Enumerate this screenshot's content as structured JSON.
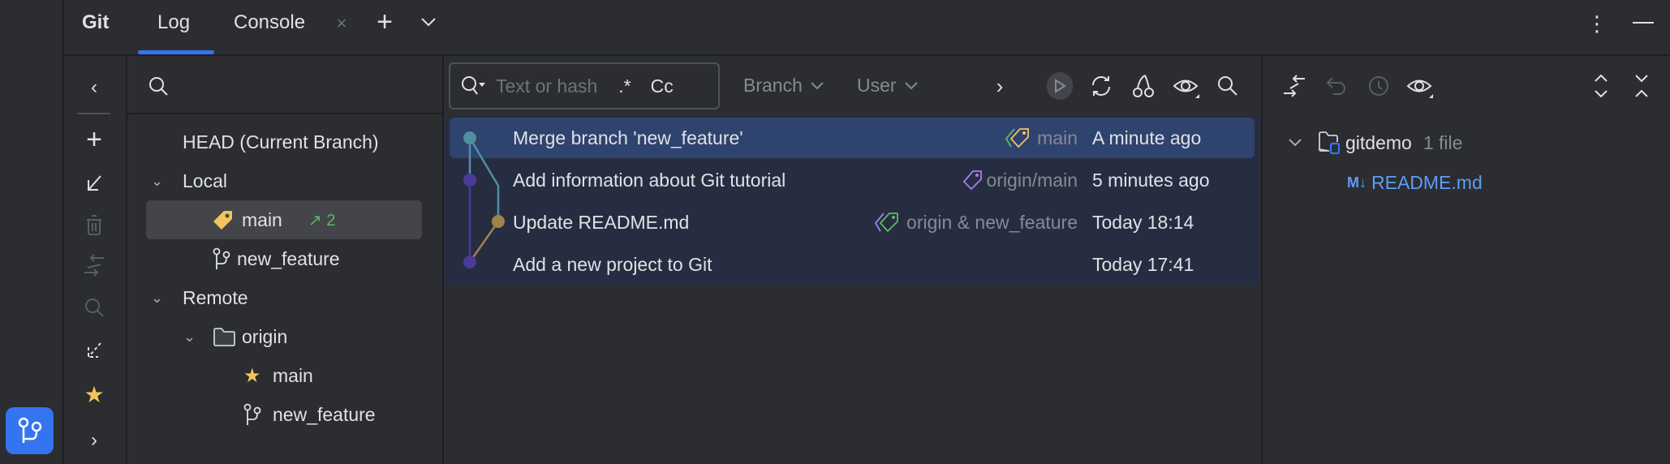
{
  "header": {
    "title": "Git",
    "tabs": [
      {
        "label": "Log",
        "active": true
      },
      {
        "label": "Console"
      }
    ]
  },
  "branches": {
    "head": "HEAD (Current Branch)",
    "local_label": "Local",
    "local": [
      {
        "name": "main",
        "ahead": "2",
        "selected": true
      },
      {
        "name": "new_feature"
      }
    ],
    "remote_label": "Remote",
    "remote_folder": "origin",
    "remote": [
      {
        "name": "main"
      },
      {
        "name": "new_feature"
      }
    ]
  },
  "log": {
    "search_placeholder": "Text or hash",
    "regex_label": ".*",
    "case_label": "Cc",
    "branch_filter": "Branch",
    "user_filter": "User",
    "commits": [
      {
        "message": "Merge branch 'new_feature'",
        "refs": "main",
        "date": "A minute ago",
        "selected": true
      },
      {
        "message": "Add information about Git tutorial",
        "refs": "origin/main",
        "date": "5 minutes ago"
      },
      {
        "message": "Update README.md",
        "refs": "origin & new_feature",
        "date": "Today 18:14"
      },
      {
        "message": "Add a new project to Git",
        "refs": "",
        "date": "Today 17:41"
      }
    ]
  },
  "changes": {
    "root": "gitdemo",
    "count": "1 file",
    "files": [
      {
        "badge": "M↓",
        "name": "README.md"
      }
    ]
  },
  "colors": {
    "accent": "#3574f0",
    "selected_row": "#2e436e",
    "row": "#272d41",
    "graph_teal": "#4f8fa0",
    "graph_purple": "#4b3a9a",
    "graph_gold": "#a08447"
  }
}
